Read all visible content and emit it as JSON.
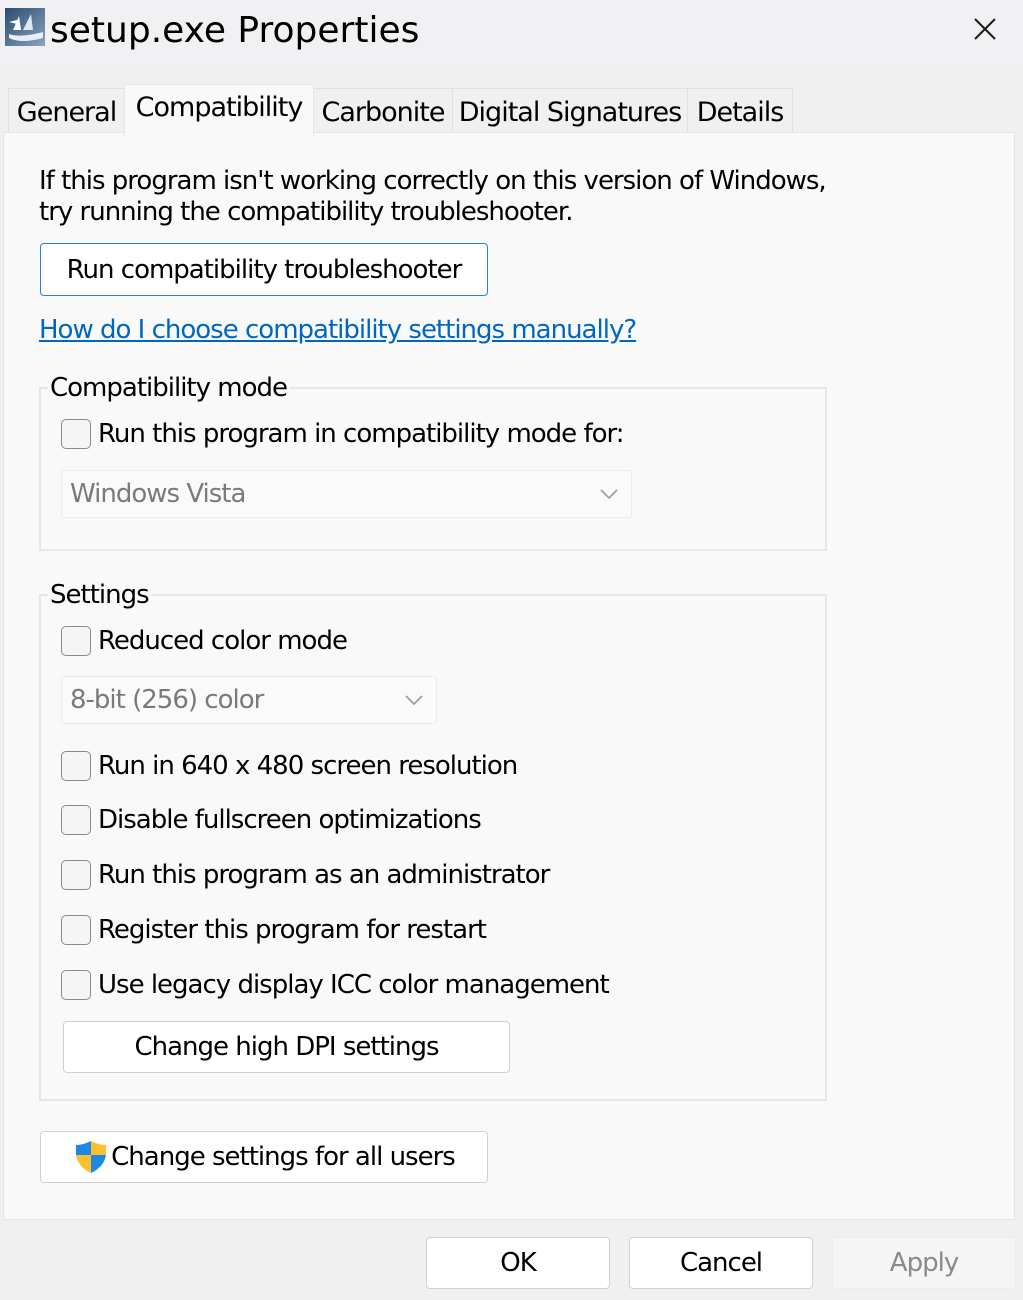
{
  "window": {
    "title": "setup.exe Properties",
    "icon": "setup-app-icon",
    "close_icon": "close-icon"
  },
  "tabs": [
    {
      "label": "General",
      "active": false
    },
    {
      "label": "Compatibility",
      "active": true
    },
    {
      "label": "Carbonite",
      "active": false
    },
    {
      "label": "Digital Signatures",
      "active": false
    },
    {
      "label": "Details",
      "active": false
    }
  ],
  "compat": {
    "intro_line1": "If this program isn't working correctly on this version of Windows,",
    "intro_line2": "try running the compatibility troubleshooter.",
    "troubleshooter_button": "Run compatibility troubleshooter",
    "help_link": "How do I choose compatibility settings manually?",
    "mode_group": {
      "label": "Compatibility mode",
      "checkbox_label": "Run this program in compatibility mode for:",
      "checked": false,
      "os_select_value": "Windows Vista",
      "os_select_enabled": false
    },
    "settings_group": {
      "label": "Settings",
      "reduced_color": {
        "label": "Reduced color mode",
        "checked": false
      },
      "color_select_value": "8-bit (256) color",
      "color_select_enabled": false,
      "options": [
        {
          "label": "Run in 640 x 480 screen resolution",
          "checked": false
        },
        {
          "label": "Disable fullscreen optimizations",
          "checked": false
        },
        {
          "label": "Run this program as an administrator",
          "checked": false
        },
        {
          "label": "Register this program for restart",
          "checked": false
        },
        {
          "label": "Use legacy display ICC color management",
          "checked": false
        }
      ],
      "dpi_button": "Change high DPI settings"
    },
    "all_users_button": "Change settings for all users",
    "all_users_icon": "uac-shield-icon"
  },
  "footer": {
    "ok": "OK",
    "cancel": "Cancel",
    "apply": "Apply",
    "apply_enabled": false
  },
  "colors": {
    "link": "#0067c0",
    "focus_border": "#2b7fd6",
    "shield_blue": "#1e88e5",
    "shield_yellow": "#fbc02d"
  }
}
